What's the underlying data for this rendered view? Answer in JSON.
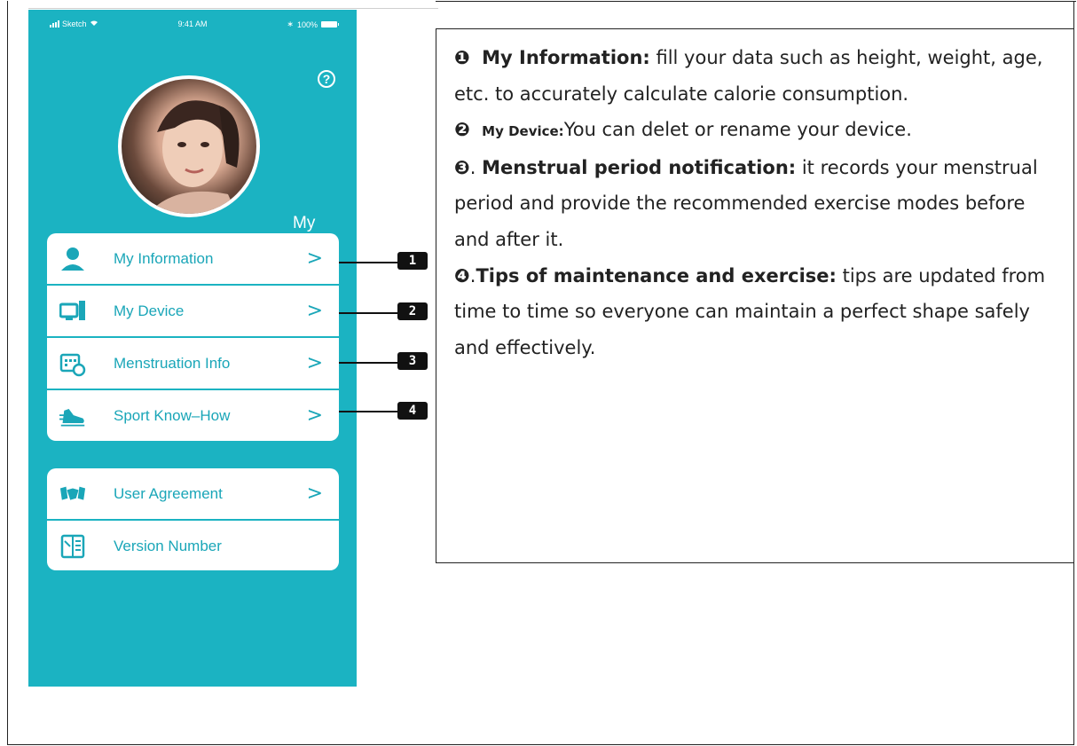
{
  "status_bar": {
    "carrier": "Sketch",
    "time": "9:41 AM",
    "battery": "100%"
  },
  "phone": {
    "title": "My",
    "menu_group_1": [
      {
        "label": "My Information",
        "icon": "person-icon"
      },
      {
        "label": "My Device",
        "icon": "computer-icon"
      },
      {
        "label": "Menstruation Info",
        "icon": "calendar-clock-icon"
      },
      {
        "label": "Sport Know–How",
        "icon": "sneaker-icon"
      }
    ],
    "menu_group_2": [
      {
        "label": "User Agreement",
        "icon": "handshake-icon"
      },
      {
        "label": "Version Number",
        "icon": "document-icon"
      }
    ],
    "chevron": ">",
    "help": "?"
  },
  "callouts": [
    "1",
    "2",
    "3",
    "4"
  ],
  "description": {
    "item1_marker": "❶",
    "item1_title": "My Information:",
    "item1_text": " fill your data such as height, weight, age, etc. to accurately calculate calorie consumption.",
    "item2_marker": "❷",
    "item2_title": "My Device:",
    "item2_text": "You can delet or rename your device.",
    "item3_marker": "❸",
    "item3_sep": ". ",
    "item3_title": "Menstrual period notification:",
    "item3_text": " it records your menstrual period and provide the recommended exercise modes before and after it.",
    "item4_marker": "❹",
    "item4_sep": ".",
    "item4_title": "Tips of maintenance and exercise:",
    "item4_text": " tips are updated from time to time so everyone can maintain a perfect shape safely and effectively."
  },
  "colors": {
    "accent": "#1bb3c2",
    "menu_text": "#1aa6b8"
  }
}
